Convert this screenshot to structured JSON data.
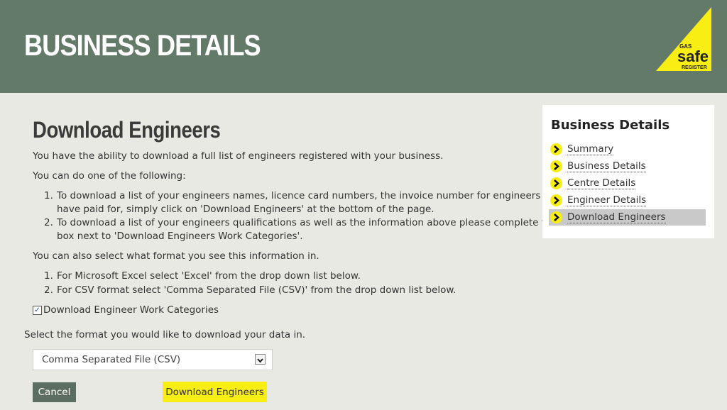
{
  "header": {
    "title": "BUSINESS DETAILS"
  },
  "logo": {
    "top_text": "GAS",
    "main_text": "safe",
    "bottom_text": "REGISTER",
    "color": "#f8ee14"
  },
  "main": {
    "title": "Download Engineers",
    "intro": "You have the ability to download a full list of engineers registered with your business.",
    "options_intro": "You can do one of the following:",
    "options": [
      {
        "number": "1.",
        "lines": [
          "To download a list of your engineers names, licence card numbers, the invoice number for engineers you",
          "have paid for, simply click on 'Download Engineers' at the bottom of the page."
        ]
      },
      {
        "number": "2.",
        "lines": [
          "To download a list of your engineers qualifications as well as the information above please complete the tick",
          "box next to 'Download Engineers Work Categories'."
        ]
      }
    ],
    "format_intro": "You can also select what format you see this information in.",
    "formats": [
      {
        "number": "1.",
        "text": "For Microsoft Excel select 'Excel' from the drop down list below."
      },
      {
        "number": "2.",
        "text": "For CSV format select 'Comma Separated File (CSV)' from the drop down list below."
      }
    ],
    "checkbox_label": "Download Engineer Work Categories",
    "checkbox_checked": true,
    "select_prompt": "Select the format you would like to download your data in.",
    "select_value": "Comma Separated File (CSV)",
    "cancel_label": "Cancel",
    "download_label": "Download Engineers"
  },
  "sidebar": {
    "title": "Business Details",
    "items": [
      {
        "label": "Summary",
        "active": false
      },
      {
        "label": "Business Details",
        "active": false
      },
      {
        "label": "Centre Details",
        "active": false
      },
      {
        "label": "Engineer Details",
        "active": false
      },
      {
        "label": "Download Engineers",
        "active": true
      }
    ]
  },
  "colors": {
    "header_bg": "#647a68",
    "page_bg": "#e9e9e4",
    "accent_yellow": "#f8ee14",
    "cancel_bg": "#5c6e61"
  }
}
